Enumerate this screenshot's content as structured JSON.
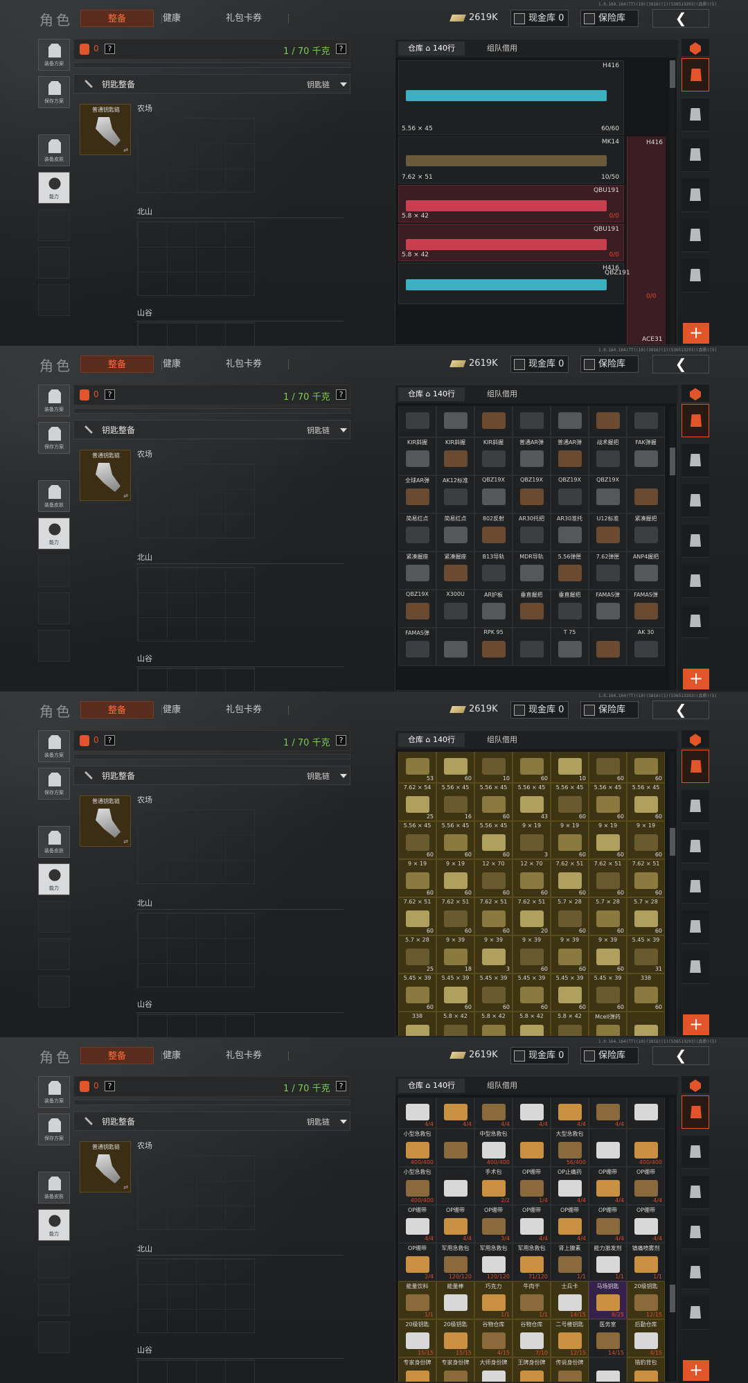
{
  "header": {
    "title": "角色",
    "tabs": [
      "整备",
      "健康",
      "礼包卡券"
    ],
    "gold_amount": "2619K",
    "cash_store": "现金库 0",
    "safe_store": "保险库",
    "back_icon": "chevron-left-icon",
    "version": "1.0.164.164(TT)(10)(3816)(1)(536513293)(品质)(5)"
  },
  "left_buttons": [
    {
      "label": "装备方案",
      "icon": "vest-icon"
    },
    {
      "label": "保存方案",
      "icon": "download-icon"
    },
    {
      "label": "装备皮肤",
      "icon": "helmet-icon"
    },
    {
      "label": "能力",
      "icon": "ability-icon"
    }
  ],
  "loadout": {
    "bag_count": "0",
    "help": "?",
    "weight": "1 / 70 千克",
    "key_section": "钥匙整备",
    "keychain": "钥匙链",
    "key_item": "普通钥匙链",
    "maps": [
      "农场",
      "北山",
      "山谷"
    ]
  },
  "stash": {
    "tabs": [
      "仓库 ⌂ 140行",
      "组队借用"
    ],
    "colors": {
      "accent": "#e2552a",
      "green": "#7cd04a",
      "gold": "#3d3414",
      "pink": "#3c1d24"
    },
    "screens": [
      {
        "kind": "weapons",
        "side_label": "H416",
        "weapons": [
          {
            "name": "H416",
            "caliber": "5.56 × 45",
            "ammo": "60/60",
            "color": "#3ab0c0",
            "red": false
          },
          {
            "name": "MK14",
            "caliber": "7.62 × 51",
            "ammo": "10/50",
            "color": "#6b5a3a",
            "red": false
          },
          {
            "name": "QBU191",
            "caliber": "5.8 × 42",
            "ammo": "0/0",
            "color": "#c84050",
            "red": true
          },
          {
            "name": "QBU191",
            "caliber": "5.8 × 42",
            "ammo": "0/0",
            "color": "#c84050",
            "red": true
          },
          {
            "name": "H416",
            "caliber": "",
            "ammo": "",
            "color": "#3ab0c0",
            "red": false
          }
        ],
        "extra": [
          "QBZ191",
          "0/0",
          "ACE31"
        ]
      },
      {
        "kind": "parts",
        "rows": [
          [
            "",
            "",
            "",
            "",
            "",
            "",
            ""
          ],
          [
            "KIR斜握",
            "KIR斜握",
            "KIR斜握",
            "普通AR弹",
            "普通AR弹",
            "战术握把",
            "FAK弹握"
          ],
          [
            "全球AR弹",
            "AK12标准",
            "QBZ19X",
            "QBZ19X",
            "QBZ19X",
            "QBZ19X",
            ""
          ],
          [
            "简易红点",
            "简易红点",
            "802反射",
            "AR30托把",
            "AR30准托",
            "U12标准",
            "紧凑握把"
          ],
          [
            "紧凑握座",
            "紧凑握座",
            "B13导轨",
            "MDR导轨",
            "5.56弹匣",
            "7.62弹匣",
            "ANP4握把"
          ],
          [
            "QBZ19X",
            "X300U",
            "AR护板",
            "垂直握把",
            "垂直握把",
            "FAMAS弹",
            "FAMAS弹"
          ],
          [
            "FAMAS弹",
            "",
            "RPK 95",
            "",
            "T 75",
            "",
            "AK 30"
          ]
        ]
      },
      {
        "kind": "ammo",
        "rows": [
          [
            [
              "",
              "53"
            ],
            [
              "",
              "60"
            ],
            [
              "",
              "10"
            ],
            [
              "",
              "60"
            ],
            [
              "",
              "10"
            ],
            [
              "",
              "60"
            ],
            [
              "",
              "60"
            ]
          ],
          [
            [
              "7.62 × 54",
              "25"
            ],
            [
              "5.56 × 45",
              "16"
            ],
            [
              "5.56 × 45",
              "60"
            ],
            [
              "5.56 × 45",
              "43"
            ],
            [
              "5.56 × 45",
              "60"
            ],
            [
              "5.56 × 45",
              "60"
            ],
            [
              "5.56 × 45",
              "60"
            ]
          ],
          [
            [
              "5.56 × 45",
              "60"
            ],
            [
              "5.56 × 45",
              "60"
            ],
            [
              "5.56 × 45",
              "60"
            ],
            [
              "9 × 19",
              "3"
            ],
            [
              "9 × 19",
              "60"
            ],
            [
              "9 × 19",
              "60"
            ],
            [
              "9 × 19",
              "60"
            ]
          ],
          [
            [
              "9 × 19",
              "60"
            ],
            [
              "9 × 19",
              "60"
            ],
            [
              "12 × 70",
              "60"
            ],
            [
              "12 × 70",
              "60"
            ],
            [
              "7.62 × 51",
              "60"
            ],
            [
              "7.62 × 51",
              "60"
            ],
            [
              "7.62 × 51",
              "60"
            ]
          ],
          [
            [
              "7.62 × 51",
              "60"
            ],
            [
              "7.62 × 51",
              "60"
            ],
            [
              "7.62 × 51",
              "60"
            ],
            [
              "7.62 × 51",
              "20"
            ],
            [
              "5.7 × 28",
              "60"
            ],
            [
              "5.7 × 28",
              "60"
            ],
            [
              "5.7 × 28",
              "60"
            ]
          ],
          [
            [
              "5.7 × 28",
              "25"
            ],
            [
              "9 × 39",
              "18"
            ],
            [
              "9 × 39",
              "3"
            ],
            [
              "9 × 39",
              "60"
            ],
            [
              "9 × 39",
              "60"
            ],
            [
              "9 × 39",
              "60"
            ],
            [
              "5.45 × 39",
              "31"
            ]
          ],
          [
            [
              "5.45 × 39",
              "60"
            ],
            [
              "5.45 × 39",
              "60"
            ],
            [
              "5.45 × 39",
              "60"
            ],
            [
              "5.45 × 39",
              "60"
            ],
            [
              "5.45 × 39",
              "60"
            ],
            [
              "5.45 × 39",
              "60"
            ],
            [
              "338",
              "60"
            ]
          ],
          [
            [
              "338",
              ""
            ],
            [
              "5.8 × 42",
              ""
            ],
            [
              "5.8 × 42",
              ""
            ],
            [
              "5.8 × 42",
              ""
            ],
            [
              "5.8 × 42",
              ""
            ],
            [
              "Mcell弹药",
              ""
            ],
            [
              "",
              ""
            ]
          ]
        ]
      },
      {
        "kind": "consumables",
        "rows": [
          [
            [
              "",
              "4/4"
            ],
            [
              "",
              "4/4"
            ],
            [
              "",
              "4/4"
            ],
            [
              "",
              "4/4"
            ],
            [
              "",
              "4/4"
            ],
            [
              "",
              "4/4"
            ],
            [
              "",
              ""
            ]
          ],
          [
            [
              "小型急救包",
              "400/400"
            ],
            [
              "",
              ""
            ],
            [
              "中型急救包",
              "400/400"
            ],
            [
              "",
              ""
            ],
            [
              "大型急救包",
              "56/400"
            ],
            [
              "",
              ""
            ],
            [
              "",
              "400/400"
            ]
          ],
          [
            [
              "小型急救包",
              "400/400"
            ],
            [
              "",
              ""
            ],
            [
              "手术包",
              "2/2"
            ],
            [
              "OP绷带",
              "1/4"
            ],
            [
              "OP止痛药",
              "4/4"
            ],
            [
              "OP绷带",
              "4/4"
            ],
            [
              "OP绷带",
              "4/4"
            ]
          ],
          [
            [
              "OP绷带",
              "4/4"
            ],
            [
              "OP绷带",
              "4/4"
            ],
            [
              "OP绷带",
              "3/4"
            ],
            [
              "OP绷带",
              "4/4"
            ],
            [
              "OP绷带",
              "4/4"
            ],
            [
              "OP绷带",
              "4/4"
            ],
            [
              "OP绷带",
              "4/4"
            ]
          ],
          [
            [
              "OP绷带",
              "2/4"
            ],
            [
              "军用急救包",
              "120/120"
            ],
            [
              "军用急救包",
              "120/120"
            ],
            [
              "军用急救包",
              "71/120"
            ],
            [
              "肾上腺素",
              "1/1"
            ],
            [
              "能力激发剂",
              "1/1"
            ],
            [
              "镇痛喷雾剂",
              "1/1"
            ]
          ],
          [
            [
              "能量饮料",
              "1/1"
            ],
            [
              "能量棒",
              ""
            ],
            [
              "巧克力",
              "1/1"
            ],
            [
              "牛肉干",
              "1/1"
            ],
            [
              "士兵卡",
              "14/15"
            ],
            [
              "马场钥匙",
              "8/25"
            ],
            [
              "20级钥匙",
              "12/15"
            ]
          ],
          [
            [
              "20级钥匙",
              "15/15"
            ],
            [
              "20级钥匙",
              "15/15"
            ],
            [
              "谷物仓库",
              "4/15"
            ],
            [
              "谷物仓库",
              "7/10"
            ],
            [
              "二号楼钥匙",
              "12/15"
            ],
            [
              "医务室",
              "14/15"
            ],
            [
              "后勤仓库",
              "4/15"
            ]
          ],
          [
            [
              "专家身份牌",
              ""
            ],
            [
              "专家身份牌",
              ""
            ],
            [
              "大师身份牌",
              ""
            ],
            [
              "王牌身份牌",
              ""
            ],
            [
              "传说身份牌",
              ""
            ],
            [
              "",
              ""
            ],
            [
              "猎豹背包",
              ""
            ]
          ]
        ]
      }
    ]
  }
}
